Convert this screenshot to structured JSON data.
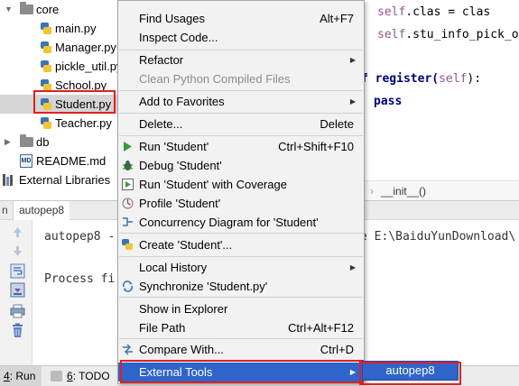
{
  "project_tree": {
    "items": [
      {
        "label": "core",
        "kind": "folder",
        "expanded": true
      },
      {
        "label": "main.py",
        "kind": "python"
      },
      {
        "label": "Manager.py",
        "kind": "python"
      },
      {
        "label": "pickle_util.py",
        "kind": "python"
      },
      {
        "label": "School.py",
        "kind": "python"
      },
      {
        "label": "Student.py",
        "kind": "python",
        "selected": true
      },
      {
        "label": "Teacher.py",
        "kind": "python"
      },
      {
        "label": "db",
        "kind": "folder",
        "expanded": false
      },
      {
        "label": "README.md",
        "kind": "markdown",
        "icon_text": "MD"
      },
      {
        "label": "External Libraries",
        "kind": "library"
      }
    ]
  },
  "editor": {
    "lines": [
      {
        "self": "self",
        "rest": ".clas = clas"
      },
      {
        "self": "self",
        "rest": ".stu_info_pick_ol"
      },
      {
        "pre": "f register(",
        "self": "self",
        "post": "):"
      },
      {
        "kw": "pass"
      }
    ],
    "breadcrumb": {
      "separator": "›",
      "item": "__init__()"
    }
  },
  "run_panel": {
    "prefix": "n",
    "tab_label": "autopep8",
    "console_lines": [
      "autopep8 -",
      "e E:\\BaiduYunDownload\\",
      "Process fi"
    ]
  },
  "bottom_bar": {
    "run_tab": {
      "num": "4",
      "label": ": Run"
    },
    "todo_tab": {
      "num": "6",
      "label": ": TODO"
    }
  },
  "context_menu": {
    "items": [
      {
        "label": "Find Usages",
        "shortcut": "Alt+F7"
      },
      {
        "label": "Inspect Code..."
      },
      {
        "label": "Refactor",
        "submenu": true
      },
      {
        "label": "Clean Python Compiled Files",
        "disabled": true
      },
      {
        "label": "Add to Favorites",
        "submenu": true
      },
      {
        "label": "Delete...",
        "shortcut": "Delete"
      },
      {
        "label": "Run 'Student'",
        "shortcut": "Ctrl+Shift+F10",
        "icon": "run-icon"
      },
      {
        "label": "Debug 'Student'",
        "icon": "debug-icon"
      },
      {
        "label": "Run 'Student' with Coverage",
        "icon": "coverage-icon"
      },
      {
        "label": "Profile 'Student'",
        "icon": "profile-icon"
      },
      {
        "label": "Concurrency Diagram for  'Student'",
        "icon": "concurrency-icon"
      },
      {
        "label": "Create 'Student'...",
        "icon": "python-icon"
      },
      {
        "label": "Local History",
        "submenu": true
      },
      {
        "label": "Synchronize 'Student.py'",
        "icon": "sync-icon"
      },
      {
        "label": "Show in Explorer"
      },
      {
        "label": "File Path",
        "shortcut": "Ctrl+Alt+F12"
      },
      {
        "label": "Compare With...",
        "shortcut": "Ctrl+D",
        "icon": "compare-icon"
      },
      {
        "label": "External Tools",
        "submenu": true,
        "highlighted": true
      }
    ],
    "submenu_arrow": "▶"
  },
  "external_tools_submenu": {
    "items": [
      {
        "label": "autopep8",
        "highlighted": true
      }
    ]
  },
  "colors": {
    "highlight": "#2f65ca",
    "annotation_red": "#e02020",
    "self_keyword": "#94558d",
    "keyword": "#000080"
  }
}
